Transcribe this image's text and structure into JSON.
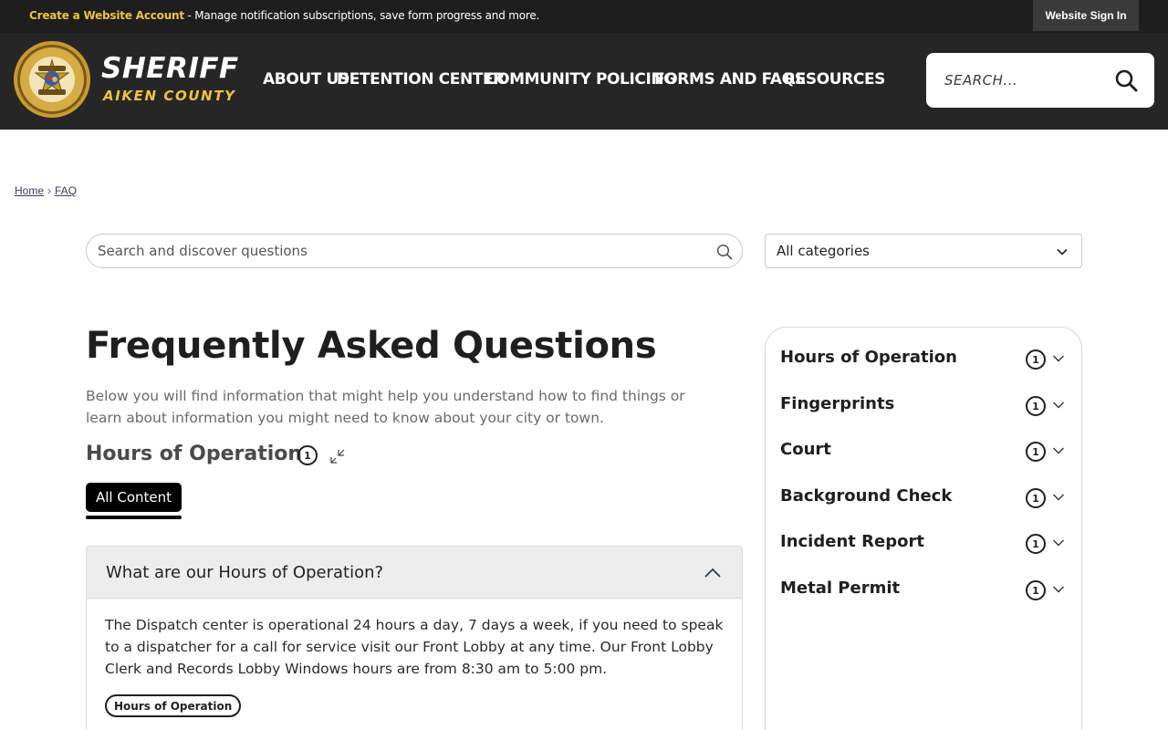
{
  "topbar": {
    "promo_link": "Create a Website Account",
    "promo_text": " - Manage notification subscriptions, save form progress and more.",
    "sign_in": "Website Sign In"
  },
  "header": {
    "brand_title": "SHERIFF",
    "brand_subtitle": "AIKEN COUNTY",
    "badge_text_top": "OFFICE OF THE SHERIFF",
    "badge_text_bottom": "AIKEN COUNTY",
    "badge_deputy": "DEPUTY",
    "badge_sheriff": "SHERIFF",
    "nav": [
      "ABOUT US",
      "DETENTION CENTER",
      "COMMUNITY POLICING",
      "FORMS AND FAQS",
      "RESOURCES"
    ],
    "search_placeholder": "SEARCH..."
  },
  "breadcrumb": {
    "home": "Home",
    "separator": "›",
    "current": "FAQ"
  },
  "faq_search": {
    "placeholder": "Search and discover questions",
    "category_value": "All categories"
  },
  "main": {
    "title": "Frequently Asked Questions",
    "intro": "Below you will find information that might help you understand how to find things or learn about information you might need to know about your city or town.",
    "section_title": "Hours of Operation",
    "section_count": "1",
    "tab_label": "All Content"
  },
  "faq_item": {
    "question": "What are our Hours of Operation?",
    "answer": "The Dispatch center is operational 24 hours a day, 7 days a week, if you need to speak to a dispatcher for a call for service visit our Front Lobby at any time. Our Front Lobby Clerk and Records Lobby Windows hours are from 8:30 am to 5:00 pm.",
    "tag": "Hours of Operation"
  },
  "sidebar": {
    "categories": [
      {
        "name": "Hours of Operation",
        "count": "1"
      },
      {
        "name": "Fingerprints",
        "count": "1"
      },
      {
        "name": "Court",
        "count": "1"
      },
      {
        "name": "Background Check",
        "count": "1"
      },
      {
        "name": "Incident Report",
        "count": "1"
      },
      {
        "name": "Metal Permit",
        "count": "1"
      }
    ]
  },
  "colors": {
    "header_bg": "#262626",
    "topbar_bg": "#1e1e1e",
    "accent_gold": "#f0c23b"
  }
}
